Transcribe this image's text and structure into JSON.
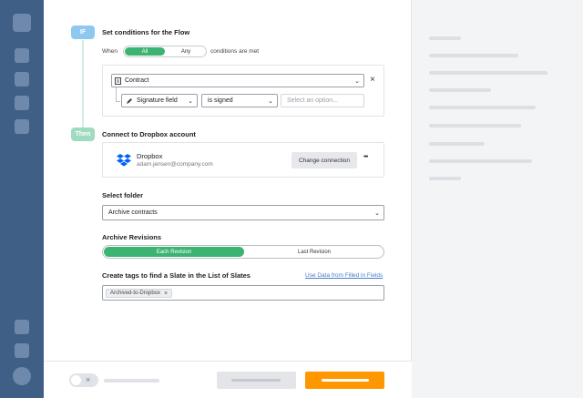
{
  "condition": {
    "if_badge": "IF",
    "title": "Set conditions for the Flow",
    "when_label": "When",
    "seg_all": "All",
    "seg_any": "Any",
    "suffix": "conditions are met",
    "document": "Contract",
    "field_select": "Signature field",
    "operator": "is signed",
    "option_placeholder": "Select an option..."
  },
  "dropbox": {
    "then_badge": "Then",
    "title": "Connect to Dropbox account",
    "service": "Dropbox",
    "email": "adam.jensen@company.com",
    "change_label": "Change connection",
    "more": "•••"
  },
  "folder": {
    "label": "Select folder",
    "value": "Archive contracts"
  },
  "revisions": {
    "label": "Archive Revisions",
    "on": "Each Revision",
    "off": "Last Revision"
  },
  "tags": {
    "label": "Create tags to find a Slate in the List of Slates",
    "link": "Use Data from Filled in Fields",
    "tag1": "Archived-to-Dropbox"
  },
  "colors": {
    "nav": "#3f5f86",
    "accent_green": "#3cb371",
    "if_blue": "#8ec8f0",
    "then_green": "#9fdcbf",
    "orange": "#ff9800"
  },
  "icons": [
    "document-icon",
    "pen-icon",
    "dropbox-icon",
    "close-icon",
    "chevron-down-icon",
    "more-icon"
  ]
}
